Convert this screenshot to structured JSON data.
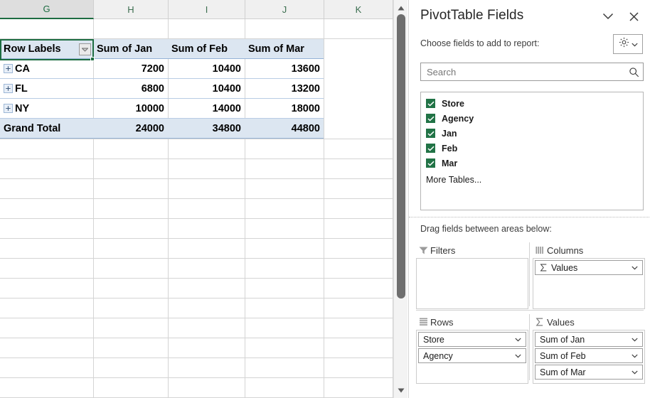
{
  "spreadsheet": {
    "column_headers": [
      "G",
      "H",
      "I",
      "J",
      "K"
    ],
    "active_column": "G",
    "pivot": {
      "header": [
        "Row Labels",
        "Sum of Jan",
        "Sum of Feb",
        "Sum of Mar"
      ],
      "rows": [
        {
          "label": "CA",
          "values": [
            "7200",
            "10400",
            "13600"
          ],
          "expandable": true
        },
        {
          "label": "FL",
          "values": [
            "6800",
            "10400",
            "13200"
          ],
          "expandable": true
        },
        {
          "label": "NY",
          "values": [
            "10000",
            "14000",
            "18000"
          ],
          "expandable": true
        }
      ],
      "grand_total": {
        "label": "Grand Total",
        "values": [
          "24000",
          "34800",
          "44800"
        ]
      }
    },
    "scrollbar": {
      "up_arrow_icon": "triangle-up-icon",
      "down_arrow_icon": "triangle-down-icon"
    }
  },
  "panel": {
    "title": "PivotTable Fields",
    "collapse_icon": "chevron-down-icon",
    "close_icon": "close-icon",
    "choose_label": "Choose fields to add to report:",
    "tools_icon": "gear-icon",
    "tools_caret_icon": "chevron-down-icon",
    "search": {
      "placeholder": "Search",
      "value": "",
      "icon": "search-icon"
    },
    "fields": [
      {
        "name": "Store",
        "checked": true
      },
      {
        "name": "Agency",
        "checked": true
      },
      {
        "name": "Jan",
        "checked": true
      },
      {
        "name": "Feb",
        "checked": true
      },
      {
        "name": "Mar",
        "checked": true
      }
    ],
    "more_tables_label": "More Tables...",
    "drag_label": "Drag fields between areas below:",
    "areas": {
      "filters": {
        "title": "Filters",
        "icon": "filter-icon",
        "items": []
      },
      "columns": {
        "title": "Columns",
        "icon": "columns-icon",
        "items": [
          {
            "label": "Values",
            "sigma": true,
            "caret_icon": "chevron-down-icon"
          }
        ]
      },
      "rows": {
        "title": "Rows",
        "icon": "rows-icon",
        "items": [
          {
            "label": "Store",
            "sigma": false,
            "caret_icon": "chevron-down-icon"
          },
          {
            "label": "Agency",
            "sigma": false,
            "caret_icon": "chevron-down-icon"
          }
        ]
      },
      "values": {
        "title": "Values",
        "icon": "sigma-icon",
        "items": [
          {
            "label": "Sum of Jan",
            "sigma": false,
            "caret_icon": "chevron-down-icon"
          },
          {
            "label": "Sum of Feb",
            "sigma": false,
            "caret_icon": "chevron-down-icon"
          },
          {
            "label": "Sum of Mar",
            "sigma": false,
            "caret_icon": "chevron-down-icon"
          }
        ]
      }
    }
  },
  "colors": {
    "excel_green": "#217346",
    "selection_green": "#1e6d42",
    "pivot_header_fill": "#dce6f1",
    "pivot_border": "#b8cce4",
    "panel_border": "#d6d6d6"
  }
}
